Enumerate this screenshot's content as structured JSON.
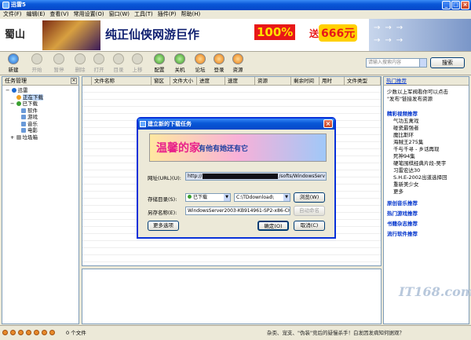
{
  "window": {
    "title": "迅雷5",
    "minimize": "_",
    "maximize": "□",
    "close": "×"
  },
  "menu": [
    "文件(F)",
    "编辑(E)",
    "查看(V)",
    "常用设置(O)",
    "窗口(W)",
    "工具(T)",
    "插件(P)",
    "帮助(H)"
  ],
  "banner": {
    "logo": "蜀山",
    "slogan": "纯正仙侠网游巨作",
    "percent": "100%",
    "song": "送",
    "yuan": "666元",
    "arrows": "→→→"
  },
  "toolbar": {
    "buttons": [
      {
        "label": "新建",
        "icon": "new-icon",
        "enabled": true
      },
      {
        "label": "开始",
        "icon": "play-icon",
        "enabled": false
      },
      {
        "label": "暂停",
        "icon": "pause-icon",
        "enabled": false
      },
      {
        "label": "删除",
        "icon": "delete-icon",
        "enabled": false
      },
      {
        "label": "打开",
        "icon": "open-icon",
        "enabled": false
      },
      {
        "label": "目录",
        "icon": "folder-icon",
        "enabled": false
      },
      {
        "label": "上移",
        "icon": "up-icon",
        "enabled": false
      },
      {
        "label": "下移",
        "icon": "down-icon",
        "enabled": false
      },
      {
        "label": "配置",
        "icon": "gear-icon",
        "enabled": true
      },
      {
        "label": "关机",
        "icon": "power-icon",
        "enabled": true
      },
      {
        "label": "论坛",
        "icon": "forum-icon",
        "enabled": true
      },
      {
        "label": "登录",
        "icon": "login-icon",
        "enabled": true
      },
      {
        "label": "资源",
        "icon": "resource-icon",
        "enabled": true
      }
    ]
  },
  "search": {
    "placeholder": "请输入搜索内容",
    "button": "搜索"
  },
  "left_pane": {
    "title": "任务管理",
    "close": "×",
    "tree": [
      {
        "label": "迅雷",
        "level": 0,
        "expander": "−"
      },
      {
        "label": "正在下载",
        "level": 1,
        "expander": ""
      },
      {
        "label": "已下载",
        "level": 1,
        "expander": "−"
      },
      {
        "label": "软件",
        "level": 2,
        "expander": ""
      },
      {
        "label": "游戏",
        "level": 2,
        "expander": ""
      },
      {
        "label": "音乐",
        "level": 2,
        "expander": ""
      },
      {
        "label": "电影",
        "level": 2,
        "expander": ""
      },
      {
        "label": "垃圾箱",
        "level": 1,
        "expander": "+"
      }
    ]
  },
  "columns": [
    "文件名称",
    "窗区",
    "文件大小",
    "进度",
    "速度",
    "资源",
    "剩余时间",
    "用时",
    "文件类型"
  ],
  "right_pane": {
    "header": "热门推荐",
    "intro": [
      "少数以上军阀看你可以点击",
      "\"发布\"链接发布资源"
    ],
    "sections": [
      {
        "title": "精彩视频推荐",
        "items": [
          "气功五禽戏",
          "碰瓷最强者",
          "魔比斯环",
          "海贼王275集",
          "千与千寻 - 乡话再现",
          "死神94集",
          "硬笔围棋经典片段-吴宇",
          "习雷宏达30",
          "S.H.E-2002出道选择回",
          "重新美少女",
          "更多"
        ]
      },
      {
        "title": "原创音乐推荐",
        "items": []
      },
      {
        "title": "热门游戏推荐",
        "items": []
      },
      {
        "title": "书籍杂志推荐",
        "items": []
      },
      {
        "title": "流行软件推荐",
        "items": []
      }
    ]
  },
  "status": {
    "text": "0 个文件",
    "ticker": "杂奀、宠支、\"伪装\"竞后的疑慢杀手！白发因发病知何据观？"
  },
  "watermark": "IT168.com",
  "dialog": {
    "title": "建立新的下载任务",
    "banner": {
      "t1": "温馨的家",
      "t2": "有他有她还有它",
      "t3": "…"
    },
    "url_label": "网址(URL)(U):",
    "url_prefix": "http://",
    "url_suffix": "/softs/WindowsServ",
    "dir_label": "存储目录(S):",
    "dir_category": "已下载",
    "dir_path": "C:\\TDdownload\\",
    "browse": "浏览(W)",
    "saveas_label": "另存名称(E):",
    "saveas_value": "WindowsServer2003-KB914961-SP2-x86-CH",
    "auto_rename": "自动命名",
    "more_options": "更多选项",
    "ok": "确定(O)",
    "cancel": "取消(C)"
  }
}
